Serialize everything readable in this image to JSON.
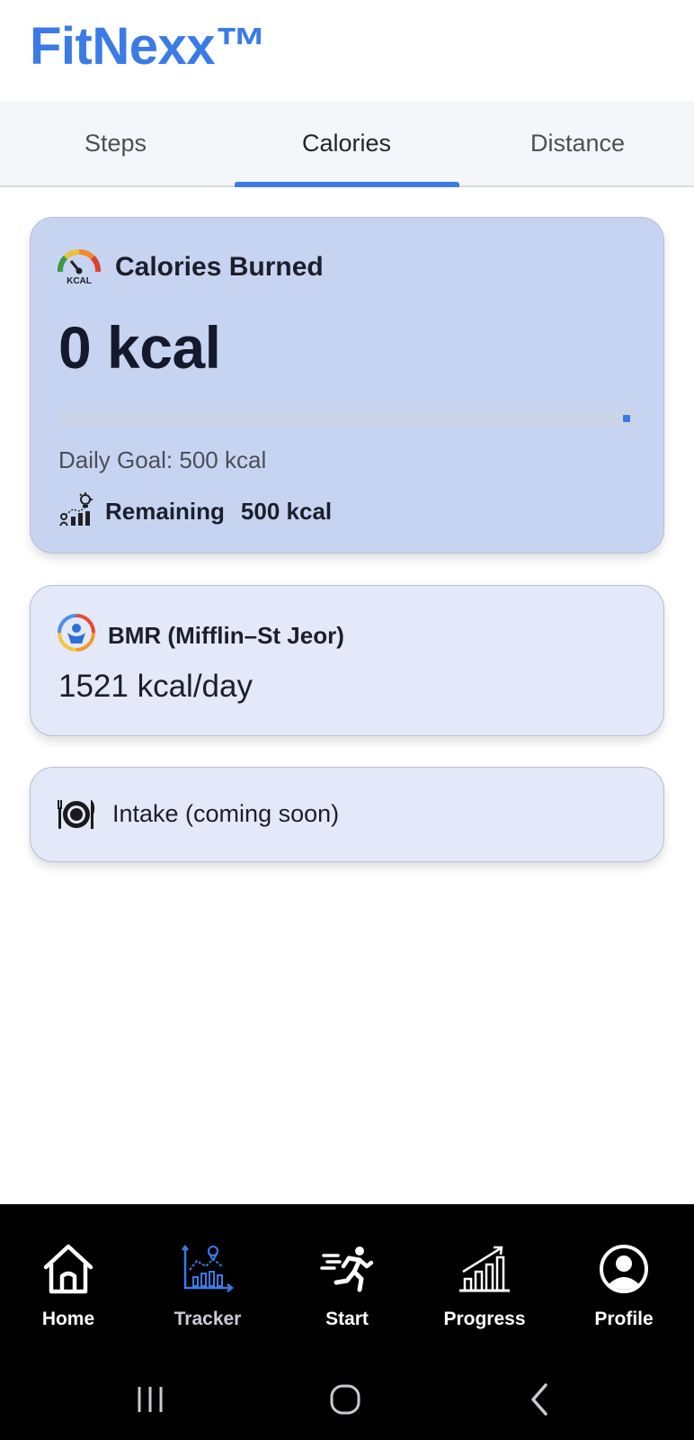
{
  "app": {
    "title": "FitNexx™"
  },
  "tabs": [
    {
      "label": "Steps",
      "active": false
    },
    {
      "label": "Calories",
      "active": true
    },
    {
      "label": "Distance",
      "active": false
    }
  ],
  "calories_card": {
    "title": "Calories Burned",
    "value": "0 kcal",
    "progress_fraction": 0,
    "goal_text": "Daily Goal: 500 kcal",
    "remaining_label": "Remaining",
    "remaining_value": "500 kcal",
    "icon": "kcal-gauge-icon",
    "remaining_icon": "remaining-chart-icon"
  },
  "bmr_card": {
    "title": "BMR (Mifflin–St Jeor)",
    "value": "1521 kcal/day",
    "icon": "bmr-person-icon"
  },
  "intake_card": {
    "text": "Intake (coming soon)",
    "icon": "plate-utensils-icon"
  },
  "bottom_nav": [
    {
      "label": "Home",
      "icon": "home-icon",
      "active": false
    },
    {
      "label": "Tracker",
      "icon": "tracker-chart-icon",
      "active": true
    },
    {
      "label": "Start",
      "icon": "running-person-icon",
      "active": false
    },
    {
      "label": "Progress",
      "icon": "bar-chart-icon",
      "active": false
    },
    {
      "label": "Profile",
      "icon": "profile-icon",
      "active": false
    }
  ],
  "system_nav": [
    "recent-apps-icon",
    "home-circle-icon",
    "back-icon"
  ],
  "colors": {
    "accent": "#3b7be6",
    "burned_card_bg": "#c7d4f1",
    "secondary_card_bg": "#e3e9f8",
    "nav_bg": "#000000"
  }
}
